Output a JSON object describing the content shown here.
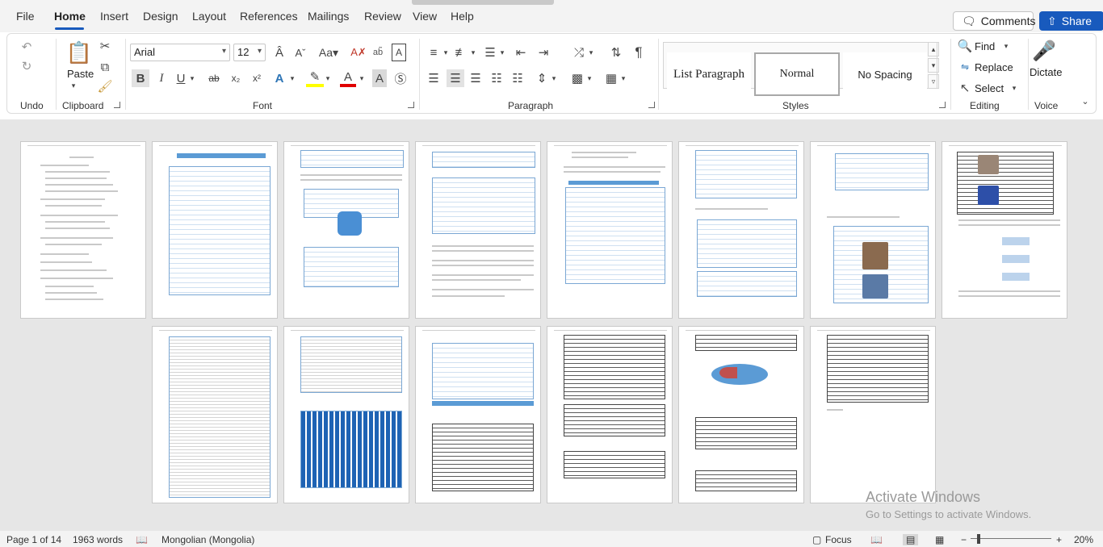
{
  "tabs": [
    "File",
    "Home",
    "Insert",
    "Design",
    "Layout",
    "References",
    "Mailings",
    "Review",
    "View",
    "Help"
  ],
  "header": {
    "comments_label": "Comments",
    "share_label": "Share"
  },
  "ribbon": {
    "undo": {
      "group_label": "Undo"
    },
    "clipboard": {
      "paste_label": "Paste",
      "group_label": "Clipboard"
    },
    "font": {
      "font_name": "Arial",
      "font_size": "12",
      "group_label": "Font"
    },
    "paragraph": {
      "group_label": "Paragraph"
    },
    "styles": {
      "items": [
        "List Paragraph",
        "Normal",
        "No Spacing"
      ],
      "selected": "Normal",
      "group_label": "Styles"
    },
    "editing": {
      "find_label": "Find",
      "replace_label": "Replace",
      "select_label": "Select",
      "group_label": "Editing"
    },
    "voice": {
      "dictate_label": "Dictate",
      "group_label": "Voice"
    }
  },
  "watermark": {
    "line1": "Activate Windows",
    "line2": "Go to Settings to activate Windows."
  },
  "status": {
    "page": "Page 1 of 14",
    "words": "1963 words",
    "language": "Mongolian (Mongolia)",
    "focus_label": "Focus",
    "zoom": "20%"
  },
  "colors": {
    "accent": "#185abd",
    "table_blue": "#5b9bd5",
    "highlight": "#ffff00",
    "font_red": "#e00000"
  }
}
